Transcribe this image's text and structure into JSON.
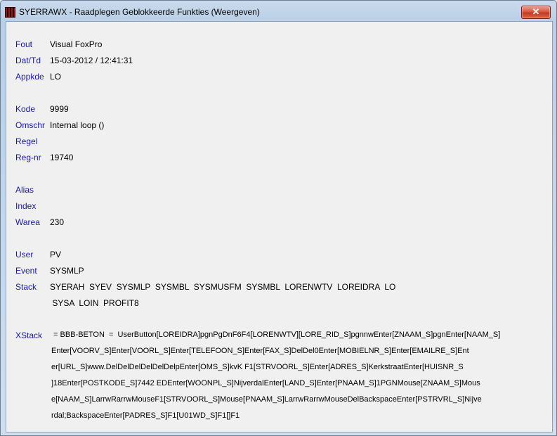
{
  "window": {
    "title": "SYERRAWX - Raadplegen Geblokkeerde Funkties (Weergeven)",
    "close_glyph": "✕"
  },
  "fields": {
    "fout": {
      "label": "Fout",
      "value": "Visual FoxPro"
    },
    "dattd": {
      "label": "Dat/Td",
      "value": "15-03-2012 / 12:41:31"
    },
    "appkde": {
      "label": "Appkde",
      "value": "LO"
    },
    "kode": {
      "label": "Kode",
      "value": "9999"
    },
    "omschr": {
      "label": "Omschr",
      "value": "Internal loop ()"
    },
    "regel": {
      "label": "Regel",
      "value": ""
    },
    "regnr": {
      "label": "Reg-nr",
      "value": "19740"
    },
    "alias": {
      "label": "Alias",
      "value": ""
    },
    "index": {
      "label": "Index",
      "value": ""
    },
    "warea": {
      "label": "Warea",
      "value": "230"
    },
    "user": {
      "label": "User",
      "value": "PV"
    },
    "event": {
      "label": "Event",
      "value": "SYSMLP"
    },
    "stack": {
      "label": "Stack",
      "lines": [
        "SYERAH  SYEV  SYSMLP  SYSMBL  SYSMUSFM  SYSMBL  LORENWTV  LOREIDRA  LO",
        " SYSA  LOIN  PROFIT8"
      ]
    },
    "xstack": {
      "label": "XStack",
      "lines": [
        " = BBB-BETON  =  UserButton[LOREIDRA]pgnPgDnF6F4[LORENWTV][LORE_RID_S]pgnnwEnter[ZNAAM_S]pgnEnter[NAAM_S]",
        "Enter[VOORV_S]Enter[VOORL_S]Enter[TELEFOON_S]Enter[FAX_S]DelDel0Enter[MOBIELNR_S]Enter[EMAILRE_S]Ent",
        "er[URL_S]www.DelDelDelDelDelDelpEnter[OMS_S]kvK F1[STRVOORL_S]Enter[ADRES_S]KerkstraatEnter[HUISNR_S",
        "]18Enter[POSTKODE_S]7442 EDEnter[WOONPL_S]NijverdalEnter[LAND_S]Enter[PNAAM_S]1PGNMouse[ZNAAM_S]Mous",
        "e[NAAM_S]LarrwRarrwMouseF1[STRVOORL_S]Mouse[PNAAM_S]LarrwRarrwMouseDelBackspaceEnter[PSTRVRL_S]Nijve",
        "rdal;BackspaceEnter[PADRES_S]F1[U01WD_S]F1[]F1"
      ]
    }
  }
}
